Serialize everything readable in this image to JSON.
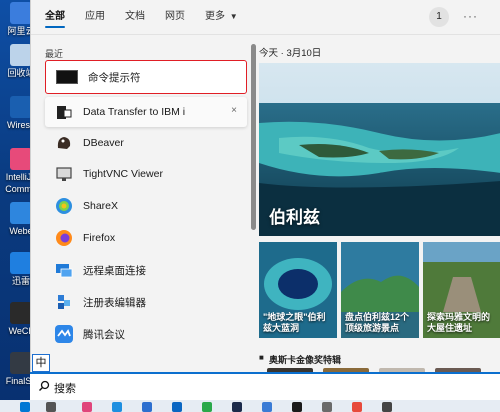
{
  "desktop": {
    "icons": [
      {
        "label": "阿里云",
        "color": "#3b7ddd"
      },
      {
        "label": "回收站",
        "color": "#bcd3ea"
      },
      {
        "label": "Wiresh",
        "color": "#1a5fb0"
      },
      {
        "label": "IntelliJ I",
        "color": "#e74a7a"
      },
      {
        "label": "Commu",
        "color": ""
      },
      {
        "label": "Webe",
        "color": "#2e86de"
      },
      {
        "label": "迅雷",
        "color": "#1f7fe0"
      },
      {
        "label": "WeCh",
        "color": "#2a2a2a"
      },
      {
        "label": "FinalSh",
        "color": "#333a44"
      }
    ]
  },
  "tabs": {
    "items": [
      "全部",
      "应用",
      "文档",
      "网页",
      "更多"
    ],
    "active": "全部",
    "badge": "1",
    "more_menu": "···"
  },
  "recent": {
    "title": "最近",
    "items": [
      {
        "label": "命令提示符",
        "icon": "cmd-icon"
      },
      {
        "label": "Data Transfer to IBM i",
        "icon": "ibm-icon",
        "close": "×"
      },
      {
        "label": "DBeaver",
        "icon": "dbeaver-icon"
      },
      {
        "label": "TightVNC Viewer",
        "icon": "vnc-icon"
      },
      {
        "label": "ShareX",
        "icon": "sharex-icon"
      },
      {
        "label": "Firefox",
        "icon": "firefox-icon"
      },
      {
        "label": "远程桌面连接",
        "icon": "remote-desktop-icon"
      },
      {
        "label": "注册表编辑器",
        "icon": "regedit-icon"
      },
      {
        "label": "腾讯会议",
        "icon": "tencent-meeting-icon"
      }
    ]
  },
  "news": {
    "date": "今天 · 3月10日",
    "hero_title": "伯利兹",
    "cards": [
      "\"地球之眼\"伯利兹大蓝洞",
      "盘点伯利兹12个顶级旅游景点",
      "探索玛雅文明的大屋住遗址"
    ],
    "section_title": "奥斯卡金像奖特辑",
    "section_icon": "■"
  },
  "search": {
    "placeholder": "搜索",
    "ime": "中"
  },
  "colors": {
    "accent": "#0067c0",
    "selection_border": "#e01e25"
  }
}
